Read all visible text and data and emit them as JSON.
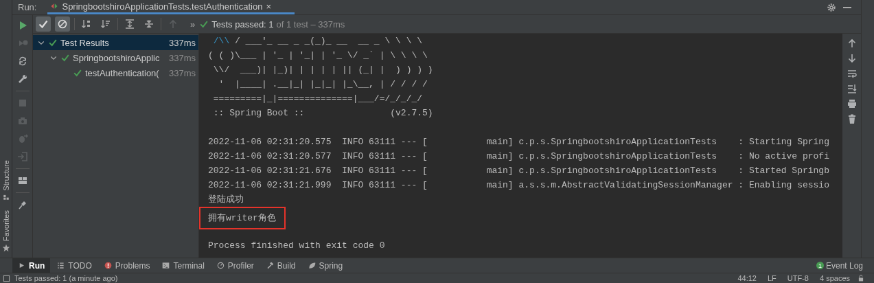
{
  "side_labels": [
    "Structure",
    "Favorites"
  ],
  "run_tab": {
    "label": "Run:",
    "title": "SpringbootshiroApplicationTests.testAuthentication",
    "close": "×"
  },
  "left_tools": [
    {
      "disabled": false
    },
    {
      "disabled": true
    },
    {
      "disabled": false
    },
    {
      "disabled": false
    },
    {
      "disabled": true
    },
    {
      "disabled": true
    },
    {
      "disabled": true
    },
    {
      "disabled": true
    },
    {
      "disabled": false
    },
    {
      "disabled": false
    }
  ],
  "toolbar": {
    "toggles": [
      {
        "selected": true
      },
      {
        "selected": true
      }
    ],
    "up_disabled": true,
    "more": "»",
    "status_main": "Tests passed: 1",
    "status_rest": "of 1 test – 337ms"
  },
  "tree": [
    {
      "label": "Test Results",
      "time": "337ms",
      "selected": true,
      "expanded": true,
      "children": [
        {
          "label": "SpringbootshiroApplic",
          "time": "337ms",
          "selected": false,
          "expanded": true,
          "children": [
            {
              "label": "testAuthentication(",
              "time": "337ms",
              "selected": false
            }
          ]
        }
      ]
    }
  ],
  "console": {
    "lines": [
      {
        "kind": "banner",
        "accent": " /\\\\",
        "text": " / ___'_ __ _ _(_)_ __  __ _ \\ \\ \\ \\"
      },
      {
        "kind": "banner",
        "text": "( ( )\\___ | '_ | '_| | '_ \\/ _` | \\ \\ \\ \\"
      },
      {
        "kind": "banner",
        "text": " \\\\/  ___)| |_)| | | | | || (_| |  ) ) ) )"
      },
      {
        "kind": "banner",
        "text": "  '  |____| .__|_| |_|_| |_\\__, | / / / /"
      },
      {
        "kind": "banner",
        "text": " =========|_|==============|___/=/_/_/_/"
      },
      {
        "kind": "banner",
        "text": " :: Spring Boot ::                (v2.7.5)"
      },
      {
        "kind": "blank"
      },
      {
        "kind": "log",
        "text": "2022-11-06 02:31:20.575  INFO 63111 --- [           main] c.p.s.SpringbootshiroApplicationTests    : Starting Spring"
      },
      {
        "kind": "log",
        "text": "2022-11-06 02:31:20.577  INFO 63111 --- [           main] c.p.s.SpringbootshiroApplicationTests    : No active profi"
      },
      {
        "kind": "log",
        "text": "2022-11-06 02:31:21.676  INFO 63111 --- [           main] c.p.s.SpringbootshiroApplicationTests    : Started Springb"
      },
      {
        "kind": "log",
        "text": "2022-11-06 02:31:21.999  INFO 63111 --- [           main] a.s.s.m.AbstractValidatingSessionManager : Enabling sessio"
      },
      {
        "kind": "log",
        "text": "登陆成功",
        "boxed": false
      },
      {
        "kind": "log",
        "text": "拥有writer角色",
        "boxed": true
      },
      {
        "kind": "blank"
      },
      {
        "kind": "log",
        "text": "Process finished with exit code 0",
        "boxed": false
      }
    ]
  },
  "tool_tabs": [
    {
      "label": "Run",
      "selected": true
    },
    {
      "label": "TODO",
      "selected": false
    },
    {
      "label": "Problems",
      "selected": false
    },
    {
      "label": "Terminal",
      "selected": false
    },
    {
      "label": "Profiler",
      "selected": false
    },
    {
      "label": "Build",
      "selected": false
    },
    {
      "label": "Spring",
      "selected": false
    }
  ],
  "event_log": {
    "label": "Event Log",
    "badge": "1"
  },
  "status": {
    "message": "Tests passed: 1 (a minute ago)",
    "items": [
      "44:12",
      "LF",
      "UTF-8",
      "4 spaces"
    ]
  }
}
